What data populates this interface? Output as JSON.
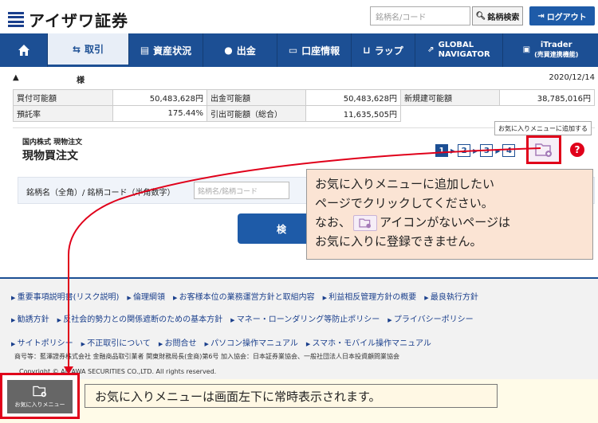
{
  "header": {
    "logo_text": "アイザワ証券",
    "search_placeholder": "銘柄名/コード",
    "search_button": "銘柄検索",
    "logout_button": "ログアウト"
  },
  "nav": {
    "home": "",
    "items": [
      {
        "label": "取引"
      },
      {
        "label": "資産状況"
      },
      {
        "label": "出金"
      },
      {
        "label": "口座情報"
      },
      {
        "label": "ラップ"
      },
      {
        "label": "GLOBAL NAVIGATOR",
        "line1": "GLOBAL",
        "line2": "NAVIGATOR"
      },
      {
        "label": "iTrader",
        "line1": "iTrader",
        "line2": "(売買連携機能)"
      }
    ]
  },
  "account": {
    "mark": "▲",
    "sama": "様",
    "date": "2020/12/14"
  },
  "balances": {
    "row1": [
      {
        "label": "買付可能額",
        "value": "50,483,628円"
      },
      {
        "label": "出金可能額",
        "value": "50,483,628円"
      },
      {
        "label": "新規建可能額",
        "value": "38,785,016円"
      }
    ],
    "row2": [
      {
        "label": "預託率",
        "value": "175.44%"
      },
      {
        "label": "引出可能額（総合）",
        "value": "11,635,505円"
      }
    ]
  },
  "order": {
    "subtitle": "国内株式 現物注文",
    "title": "現物買注文",
    "steps": [
      "1",
      "2",
      "3",
      "4"
    ],
    "fav_tooltip": "お気に入りメニューに追加する"
  },
  "symbol": {
    "label": "銘柄名（全角）/ 銘柄コード（半角数字）",
    "placeholder": "銘柄名/銘柄コード",
    "confirm": "検"
  },
  "callout": {
    "line1": "お気に入りメニューに追加したい",
    "line2": "ページでクリックしてください。",
    "line3a": "なお、",
    "line3b": "アイコンがないページは",
    "line4": "お気に入りに登録できません。"
  },
  "footer": {
    "links1": [
      "重要事項説明書(リスク説明)",
      "倫理綱領",
      "お客様本位の業務運営方針と取組内容",
      "利益相反管理方針の概要",
      "最良執行方針"
    ],
    "links2": [
      "勧誘方針",
      "反社会的勢力との関係遮断のための基本方針",
      "マネー・ローンダリング等防止ポリシー",
      "プライバシーポリシー"
    ],
    "links3": [
      "サイトポリシー",
      "不正取引について",
      "お問合せ",
      "パソコン操作マニュアル",
      "スマホ・モバイル操作マニュアル"
    ],
    "trade_name": "商号等：藍澤證券株式会社 金融商品取引業者 関東財務局長(金商)第6号 加入協会：日本証券業協会、一般社団法人日本投資顧問業協会",
    "copyright": "Copyright © AIZAWA SECURITIES CO.,LTD. All rights reserved."
  },
  "fav_menu": {
    "label": "お気に入りメニュー"
  },
  "bottom_callout": "お気に入りメニューは画面左下に常時表示されます。",
  "colors": {
    "brand": "#1c4f94",
    "highlight": "#e0001a",
    "callout_bg": "#fbe4d4"
  }
}
